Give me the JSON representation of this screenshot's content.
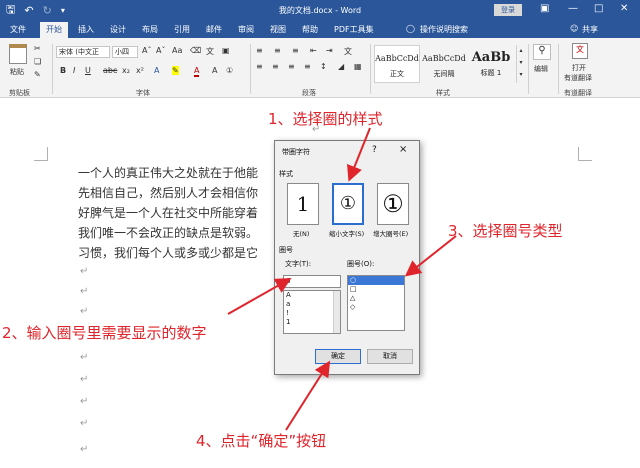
{
  "titlebar": {
    "save_icon": "save-icon",
    "undo_icon": "undo-icon",
    "redo_icon": "redo-icon",
    "document_title": "我的文档.docx - Word",
    "login_label": "登录",
    "minimize_icon": "minimize-icon",
    "restore_icon": "restore-icon",
    "close_icon": "close-icon"
  },
  "menu": {
    "tabs": [
      "文件",
      "开始",
      "插入",
      "设计",
      "布局",
      "引用",
      "邮件",
      "审阅",
      "视图",
      "帮助",
      "PDF工具集"
    ],
    "active_tab": "开始",
    "search_label": "操作说明搜索",
    "share_label": "共享"
  },
  "ribbon": {
    "clipboard": {
      "paste_label": "粘贴",
      "group_label": "剪贴板"
    },
    "font": {
      "font_name": "宋体 (中文正",
      "font_size": "小四",
      "group_label": "字体",
      "change_case": "Aa",
      "font_color_glyph": "A"
    },
    "paragraph": {
      "group_label": "段落"
    },
    "styles": {
      "items": [
        {
          "sample": "AaBbCcDd",
          "name": "正文"
        },
        {
          "sample": "AaBbCcDd",
          "name": "无间隔"
        },
        {
          "sample": "AaBb",
          "name": "标题 1"
        }
      ],
      "group_label": "样式"
    },
    "editing": {
      "label": "编辑"
    },
    "translate": {
      "open_label": "打开",
      "label_line1": "有道翻译",
      "group_label": "有道翻译"
    }
  },
  "document": {
    "lines": [
      "一个人的真正伟大之处就在于他能",
      "先相信自己，然后别人才会相信你",
      "好脾气是一个人在社交中所能穿着",
      "我们唯一不会改正的缺点是软弱。",
      "习惯，我们每个人或多或少都是它"
    ],
    "paragraph_mark": "↵"
  },
  "dialog": {
    "title": "带圈字符",
    "help": "?",
    "close": "×",
    "style_section": "样式",
    "styles": [
      {
        "glyph": "1",
        "label": "无(N)"
      },
      {
        "glyph": "①",
        "label": "缩小文字(S)"
      },
      {
        "glyph": "①",
        "label": "增大圈号(E)"
      }
    ],
    "selected_style": "缩小文字(S)",
    "enclose_section": "圈号",
    "text_label": "文字(T):",
    "text_value": "6",
    "text_list": [
      "A",
      "a",
      "!",
      "1"
    ],
    "enclosure_label": "圈号(O):",
    "enclosure_list": [
      "○",
      "□",
      "△",
      "◇"
    ],
    "selected_enclosure": "○",
    "ok_label": "确定",
    "cancel_label": "取消"
  },
  "annotations": {
    "step1": "1、选择圈的样式",
    "step2": "2、输入圈号里需要显示的数字",
    "step3": "3、选择圈号类型",
    "step4": "4、点击“确定”按钮"
  },
  "colors": {
    "accent": "#2b579a",
    "annotation": "#e0242b",
    "selection": "#3a77d6"
  }
}
